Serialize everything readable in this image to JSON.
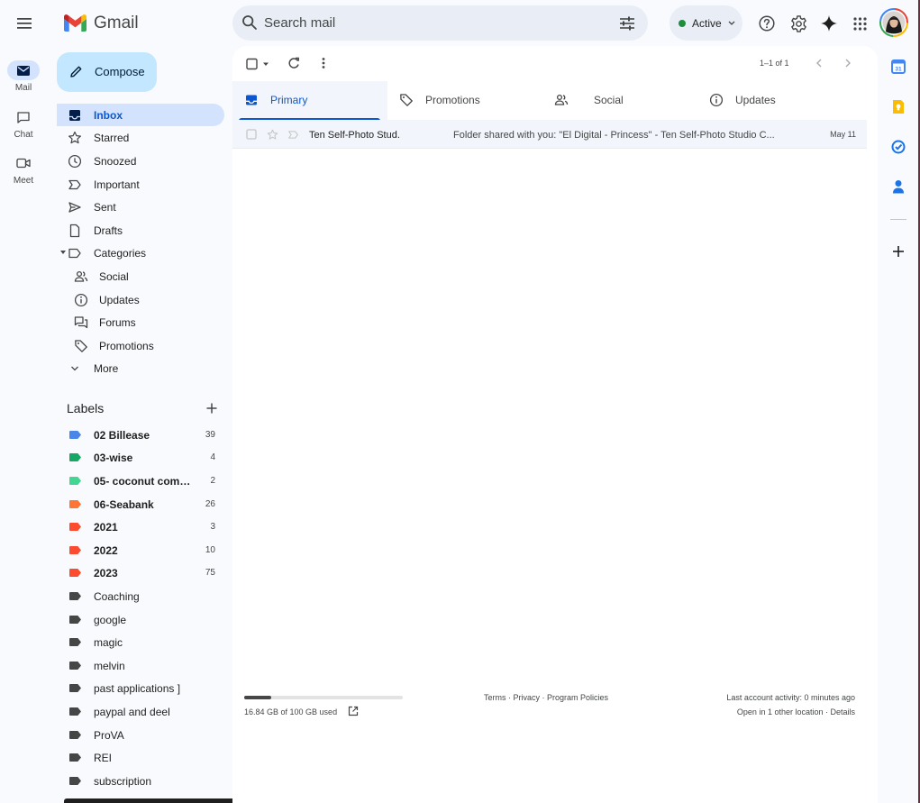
{
  "app": {
    "logo_text": "Gmail",
    "brand_colors": {
      "red": "#ea4335",
      "blue": "#4285f4",
      "green": "#34a853",
      "yellow": "#fbbc04"
    }
  },
  "rail": [
    {
      "label": "Mail",
      "icon": "mail-icon",
      "active": true
    },
    {
      "label": "Chat",
      "icon": "chat-icon",
      "active": false
    },
    {
      "label": "Meet",
      "icon": "video-icon",
      "active": false
    }
  ],
  "search": {
    "placeholder": "Search mail"
  },
  "status": {
    "label": "Active",
    "color": "#1e8e3e"
  },
  "compose": {
    "label": "Compose"
  },
  "nav": [
    {
      "label": "Inbox",
      "icon": "inbox-icon",
      "active": true
    },
    {
      "label": "Starred",
      "icon": "star-icon"
    },
    {
      "label": "Snoozed",
      "icon": "clock-icon"
    },
    {
      "label": "Important",
      "icon": "important-icon"
    },
    {
      "label": "Sent",
      "icon": "send-icon"
    },
    {
      "label": "Drafts",
      "icon": "draft-icon"
    },
    {
      "label": "Categories",
      "icon": "label-icon"
    },
    {
      "label": "Social",
      "icon": "people-icon"
    },
    {
      "label": "Updates",
      "icon": "info-icon"
    },
    {
      "label": "Forums",
      "icon": "forum-icon"
    },
    {
      "label": "Promotions",
      "icon": "tag-icon"
    },
    {
      "label": "More",
      "icon": "chevron-down-icon"
    }
  ],
  "labels": {
    "heading": "Labels",
    "items": [
      {
        "name": "02 Billease",
        "count": "39",
        "color": "#4a86e8",
        "bold": true
      },
      {
        "name": "03-wise",
        "count": "4",
        "color": "#16a765",
        "bold": true
      },
      {
        "name": "05- coconut comm...",
        "count": "2",
        "color": "#43d692",
        "bold": true
      },
      {
        "name": "06-Seabank",
        "count": "26",
        "color": "#ff7537",
        "bold": true
      },
      {
        "name": "2021",
        "count": "3",
        "color": "#fb4c2f",
        "bold": true
      },
      {
        "name": "2022",
        "count": "10",
        "color": "#fb4c2f",
        "bold": true
      },
      {
        "name": "2023",
        "count": "75",
        "color": "#fb4c2f",
        "bold": true
      },
      {
        "name": "Coaching",
        "count": "",
        "color": "#444746",
        "bold": false
      },
      {
        "name": "google",
        "count": "",
        "color": "#444746",
        "bold": false
      },
      {
        "name": "magic",
        "count": "",
        "color": "#444746",
        "bold": false
      },
      {
        "name": "melvin",
        "count": "",
        "color": "#444746",
        "bold": false
      },
      {
        "name": "past applications ]",
        "count": "",
        "color": "#444746",
        "bold": false
      },
      {
        "name": "paypal and deel",
        "count": "",
        "color": "#444746",
        "bold": false
      },
      {
        "name": "ProVA",
        "count": "",
        "color": "#444746",
        "bold": false
      },
      {
        "name": "REI",
        "count": "",
        "color": "#444746",
        "bold": false
      },
      {
        "name": "subscription",
        "count": "",
        "color": "#444746",
        "bold": false
      }
    ]
  },
  "toolbar": {
    "pagination": "1–1 of 1"
  },
  "tabs": [
    {
      "label": "Primary",
      "icon": "inbox-icon",
      "active": true
    },
    {
      "label": "Promotions",
      "icon": "tag-icon",
      "active": false
    },
    {
      "label": "Social",
      "icon": "people-icon",
      "active": false
    },
    {
      "label": "Updates",
      "icon": "info-icon",
      "active": false
    }
  ],
  "emails": [
    {
      "sender": "Ten Self-Photo Stud.",
      "subject": "Folder shared with you: \"El Digital - Princess\" - Ten Self-Photo Studio C...",
      "date": "May 11"
    }
  ],
  "footer": {
    "storage_text": "16.84 GB of 100 GB used",
    "storage_fraction": 0.168,
    "links": "Terms · Privacy · Program Policies",
    "activity": "Last account activity: 0 minutes ago",
    "activity_detail": "Open in 1 other location · Details"
  },
  "side_panel": [
    {
      "icon": "calendar-icon",
      "color": "#4285f4",
      "text": "31"
    },
    {
      "icon": "keep-icon",
      "color": "#fbbc04"
    },
    {
      "icon": "tasks-icon",
      "color": "#1a73e8"
    },
    {
      "icon": "contacts-icon",
      "color": "#1a73e8"
    },
    {
      "icon": "add-icon",
      "color": "#1f1f1f"
    }
  ]
}
